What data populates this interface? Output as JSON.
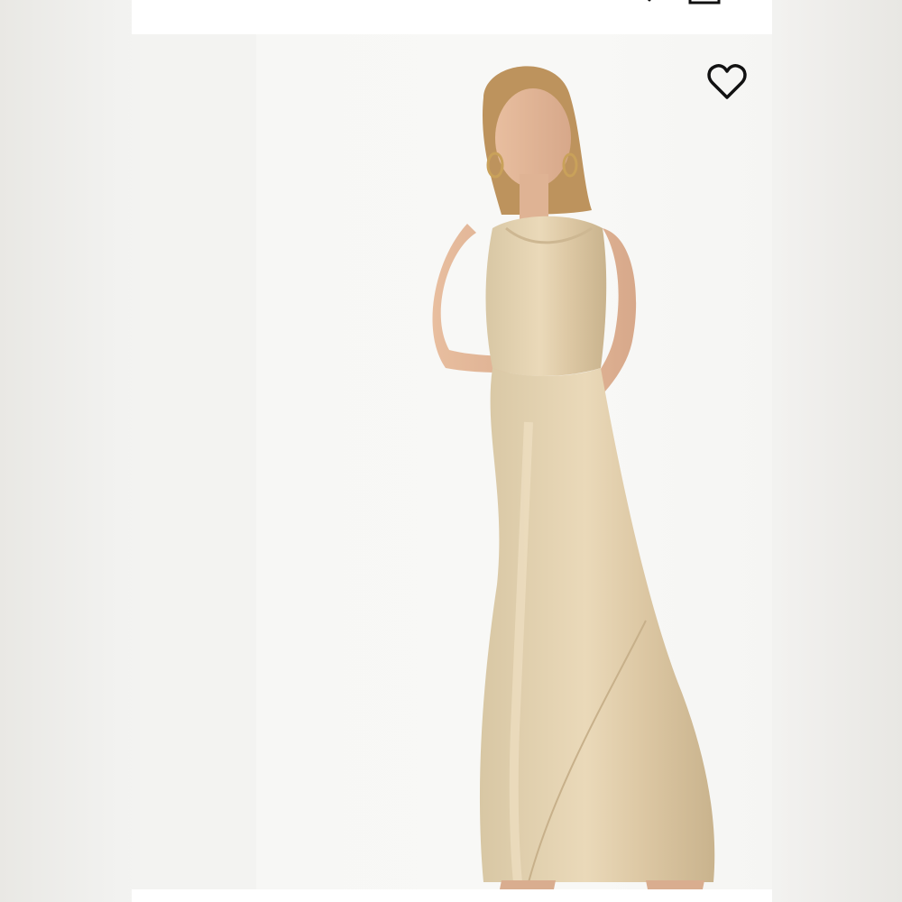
{
  "header": {
    "icons": {
      "menu": "menu-icon",
      "search": "search-icon",
      "bag": "shopping-bag-icon"
    }
  },
  "product": {
    "image_subject": "product-photo",
    "favorite_icon": "heart-outline-icon"
  },
  "colors": {
    "background": "#ecece9",
    "frame": "#ffffff",
    "photo_background": "#f7f7f5",
    "dress": "#d9c7a3",
    "skin": "#e8bea0",
    "hair": "#b98d55",
    "icon_stroke": "#111111"
  }
}
